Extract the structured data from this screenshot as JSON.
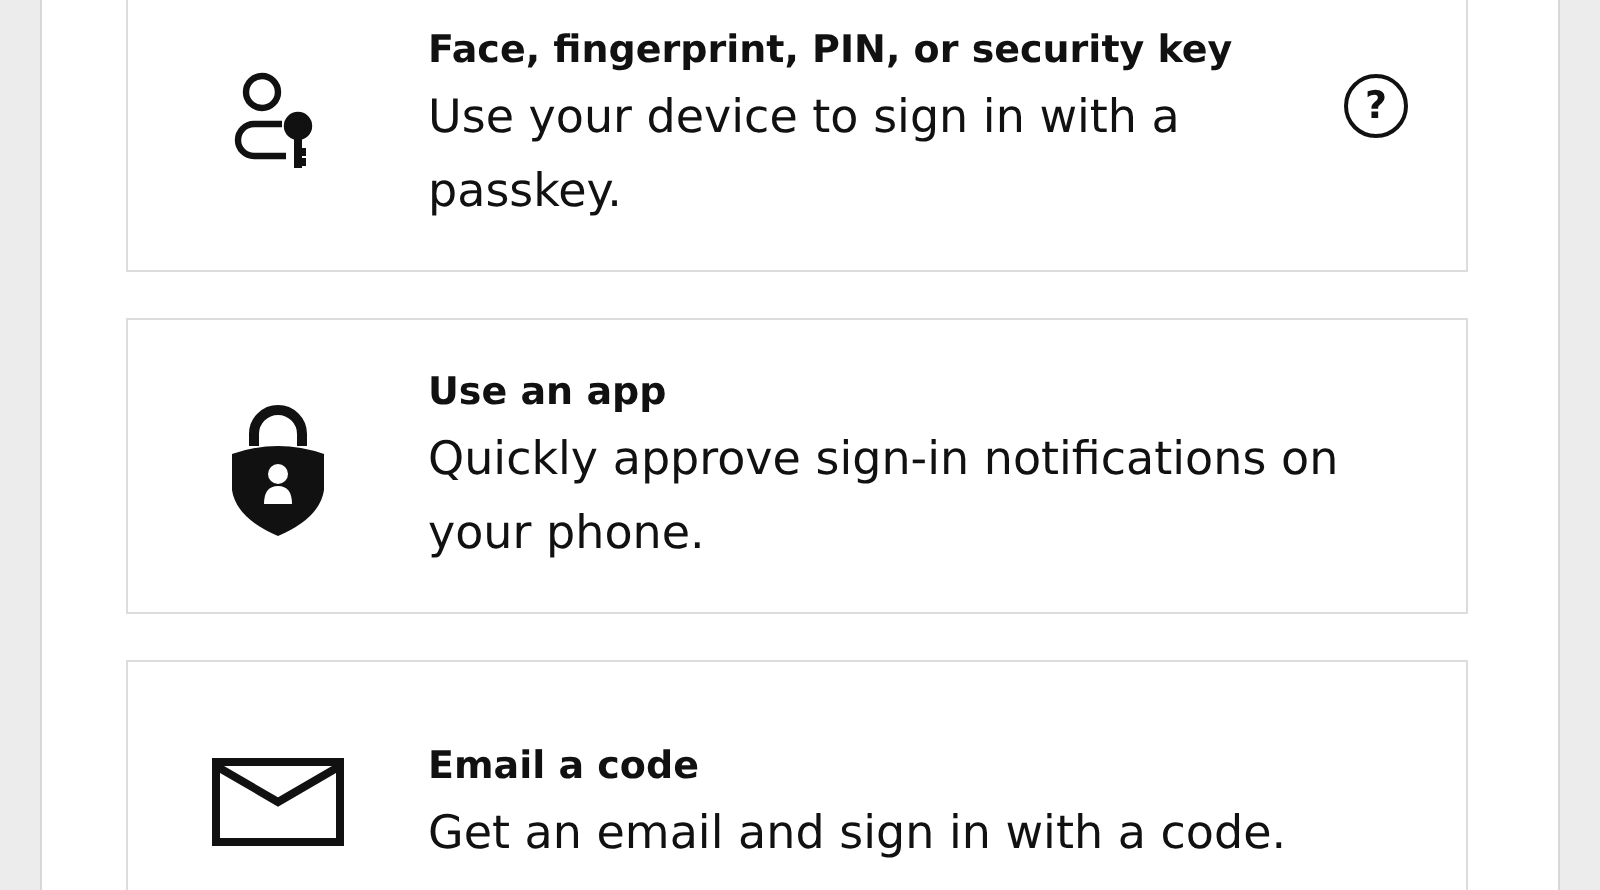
{
  "options": [
    {
      "kind": "passkey",
      "title": "Face, fingerprint, PIN, or security key",
      "description": "Use your device to sign in with a passkey.",
      "help": "?"
    },
    {
      "kind": "app",
      "title": "Use an app",
      "description": "Quickly approve sign-in notifications on your phone."
    },
    {
      "kind": "email",
      "title": "Email a code",
      "description": "Get an email and sign in with a  code."
    }
  ]
}
